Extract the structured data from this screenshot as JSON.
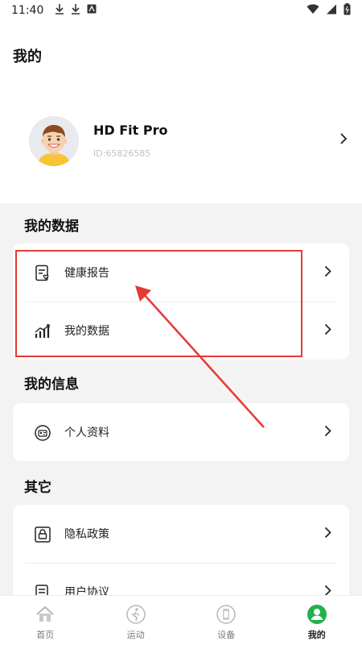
{
  "status_bar": {
    "time": "11:40"
  },
  "page": {
    "title": "我的"
  },
  "profile": {
    "name": "HD Fit Pro",
    "id_text": "ID:65826585"
  },
  "sections": [
    {
      "title": "我的数据",
      "items": [
        {
          "label": "健康报告",
          "icon": "health-report-icon"
        },
        {
          "label": "我的数据",
          "icon": "bar-chart-icon"
        }
      ]
    },
    {
      "title": "我的信息",
      "items": [
        {
          "label": "个人资料",
          "icon": "profile-card-icon"
        }
      ]
    },
    {
      "title": "其它",
      "items": [
        {
          "label": "隐私政策",
          "icon": "privacy-lock-icon"
        },
        {
          "label": "用户协议",
          "icon": "agreement-icon"
        }
      ]
    }
  ],
  "tabs": [
    {
      "label": "首页",
      "icon": "home-icon"
    },
    {
      "label": "运动",
      "icon": "running-icon"
    },
    {
      "label": "设备",
      "icon": "watch-icon"
    },
    {
      "label": "我的",
      "icon": "user-icon",
      "active": true
    }
  ],
  "colors": {
    "accent": "#22b14c",
    "highlight": "#e53935",
    "background": "#f3f3f3"
  }
}
